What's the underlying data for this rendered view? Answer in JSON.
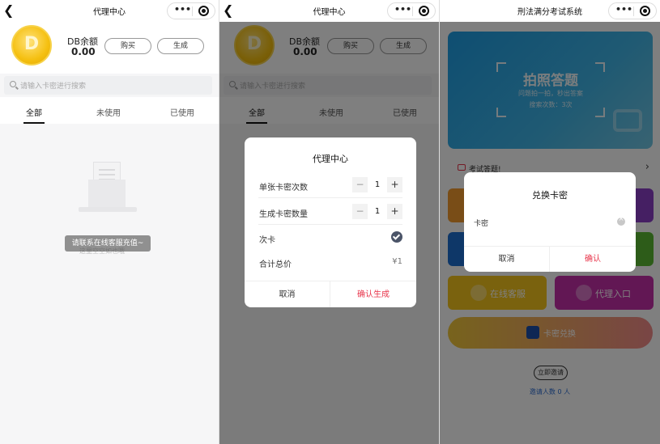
{
  "panel1": {
    "title": "代理中心",
    "balance_label": "DB余额",
    "balance_value": "0.00",
    "coin_letter": "D",
    "buy_label": "购买",
    "generate_label": "生成",
    "search_placeholder": "请输入卡密进行搜索",
    "tabs": [
      "全部",
      "未使用",
      "已使用"
    ],
    "toast": "请联系在线客服充值~",
    "empty_text": "这里空空如也哦"
  },
  "panel2": {
    "title": "代理中心",
    "balance_label": "DB余额",
    "balance_value": "0.00",
    "coin_letter": "D",
    "buy_label": "购买",
    "generate_label": "生成",
    "search_placeholder": "请输入卡密进行搜索",
    "tabs": [
      "全部",
      "未使用",
      "已使用"
    ],
    "modal": {
      "title": "代理中心",
      "row1_label": "单张卡密次数",
      "row1_value": "1",
      "row2_label": "生成卡密数量",
      "row2_value": "1",
      "row3_label": "次卡",
      "row4_label": "合计总价",
      "row4_value": "¥1",
      "minus": "−",
      "plus": "+",
      "cancel": "取消",
      "confirm": "确认生成"
    }
  },
  "panel3": {
    "title": "刑法满分考试系统",
    "banner_title": "拍照答题",
    "banner_sub": "问题拍一拍，秒出答案",
    "banner_count": "搜索次数：3次",
    "notice": "考试答题!",
    "tiles": [
      "在线客服",
      "代理入口"
    ],
    "wide_button": "卡密兑换",
    "invite_button": "立即邀请",
    "invite_count": "邀请人数 0 人",
    "modal": {
      "title": "兑换卡密",
      "field_label": "卡密",
      "cancel": "取消",
      "confirm": "确认"
    }
  },
  "capsule": {
    "dots": "•••"
  },
  "colors": {
    "accent_red": "#e8354b",
    "banner_blue": "#1d9de5",
    "coin_gold": "#f5c011"
  }
}
